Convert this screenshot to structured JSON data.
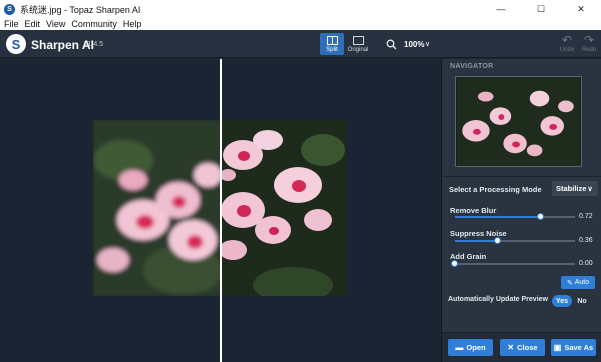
{
  "window": {
    "title": "系统迷.jpg - Topaz Sharpen AI",
    "buttons": {
      "minimize": "—",
      "maximize": "☐",
      "close": "✕"
    }
  },
  "menu": [
    "File",
    "Edit",
    "View",
    "Community",
    "Help"
  ],
  "app": {
    "name": "Sharpen AI",
    "version": "v1.4.5",
    "logo_letter": "S"
  },
  "toolbar": {
    "split_label": "Split",
    "original_label": "Original",
    "zoom": "100%",
    "zoom_caret": "∨",
    "undo_label": "Undo",
    "redo_label": "Redo",
    "undo_glyph": "↶",
    "redo_glyph": "↷"
  },
  "panel": {
    "navigator_label": "NAVIGATOR",
    "processing_label": "Select a Processing Mode",
    "processing_mode": "Stabilize",
    "sliders": [
      {
        "label": "Remove Blur",
        "value": 0.72,
        "value_text": "0.72"
      },
      {
        "label": "Suppress Noise",
        "value": 0.36,
        "value_text": "0.36"
      },
      {
        "label": "Add Grain",
        "value": 0.0,
        "value_text": "0.00"
      }
    ],
    "auto_label": "Auto",
    "update_preview_label": "Automatically Update Preview",
    "toggle_yes": "Yes",
    "toggle_no": "No",
    "open_label": "Open",
    "close_label": "Close",
    "save_as_label": "Save As"
  },
  "colors": {
    "accent": "#2f7ed8",
    "panel_bg": "#2a3441",
    "canvas_bg": "#1b2432"
  }
}
